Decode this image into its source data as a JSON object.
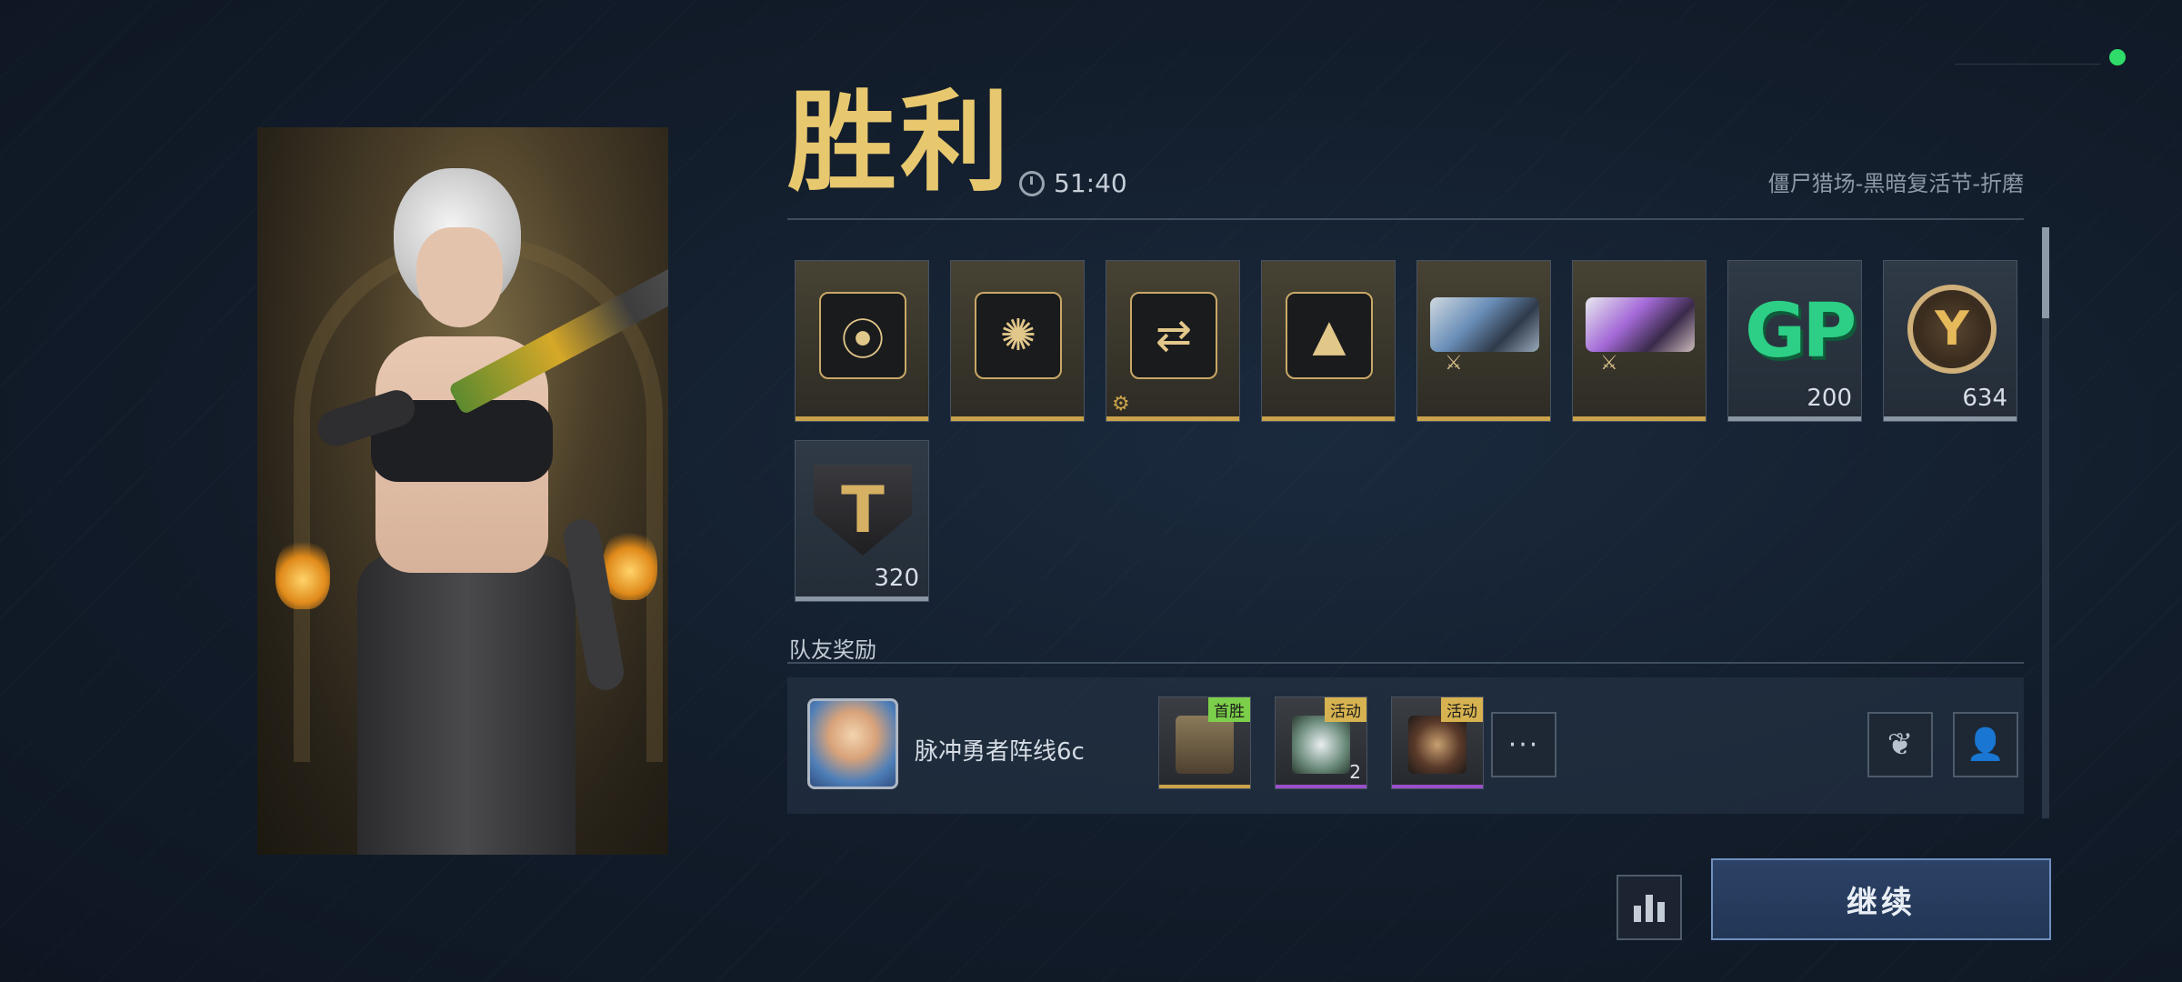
{
  "header": {
    "title": "胜利",
    "timer": "51:40",
    "mode": "僵尸猎场-黑暗复活节-折磨"
  },
  "rewards": [
    {
      "icon": "bullet-stack-icon",
      "qty": ""
    },
    {
      "icon": "blast-emblem-icon",
      "qty": ""
    },
    {
      "icon": "weapon-swap-icon",
      "qty": ""
    },
    {
      "icon": "arrowhead-emblem-icon",
      "qty": ""
    },
    {
      "icon": "pistol-weapon-icon",
      "qty": ""
    },
    {
      "icon": "purple-pistol-weapon-icon",
      "qty": ""
    },
    {
      "icon": "gp-currency-icon",
      "label": "GP",
      "qty": "200"
    },
    {
      "icon": "t-coin-icon",
      "qty": "634"
    },
    {
      "icon": "t-shield-icon",
      "qty": "320"
    }
  ],
  "team": {
    "section_label": "队友奖励",
    "player_name": "脉冲勇者阵线6c",
    "rewards": [
      {
        "tag": "首胜",
        "icon": "treasure-chest-icon",
        "qty": "",
        "tag_color": "#7ccf4a",
        "bar_color": "#c9a24a"
      },
      {
        "tag": "活动",
        "icon": "white-wolf-icon",
        "qty": "2",
        "tag_color": "#d6b250",
        "bar_color": "#9a4fc9"
      },
      {
        "tag": "活动",
        "icon": "dark-crest-icon",
        "qty": "",
        "tag_color": "#d6b250",
        "bar_color": "#9a4fc9"
      }
    ],
    "more_label": "···"
  },
  "buttons": {
    "continue_label": "继续"
  },
  "colors": {
    "title_gold": "#e8c86f",
    "status_green": "#2fdc6a",
    "continue_blue": "#2c4266"
  }
}
